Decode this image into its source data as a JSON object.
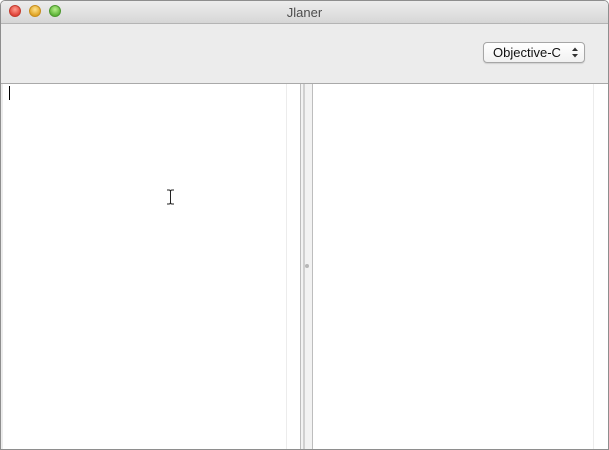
{
  "window": {
    "title": "Jlaner"
  },
  "toolbar": {
    "language_popup": {
      "selected": "Objective-C"
    }
  },
  "editors": {
    "left": {
      "content": ""
    },
    "right": {
      "content": ""
    }
  },
  "icons": {
    "close": "close-icon",
    "minimize": "minimize-icon",
    "zoom": "zoom-icon",
    "popup_arrows": "updown-arrows-icon",
    "cursor": "ibeam-cursor-icon"
  },
  "colors": {
    "close": "#e0443a",
    "minimize": "#e0a526",
    "zoom": "#5fb53a",
    "chrome": "#ececec"
  }
}
